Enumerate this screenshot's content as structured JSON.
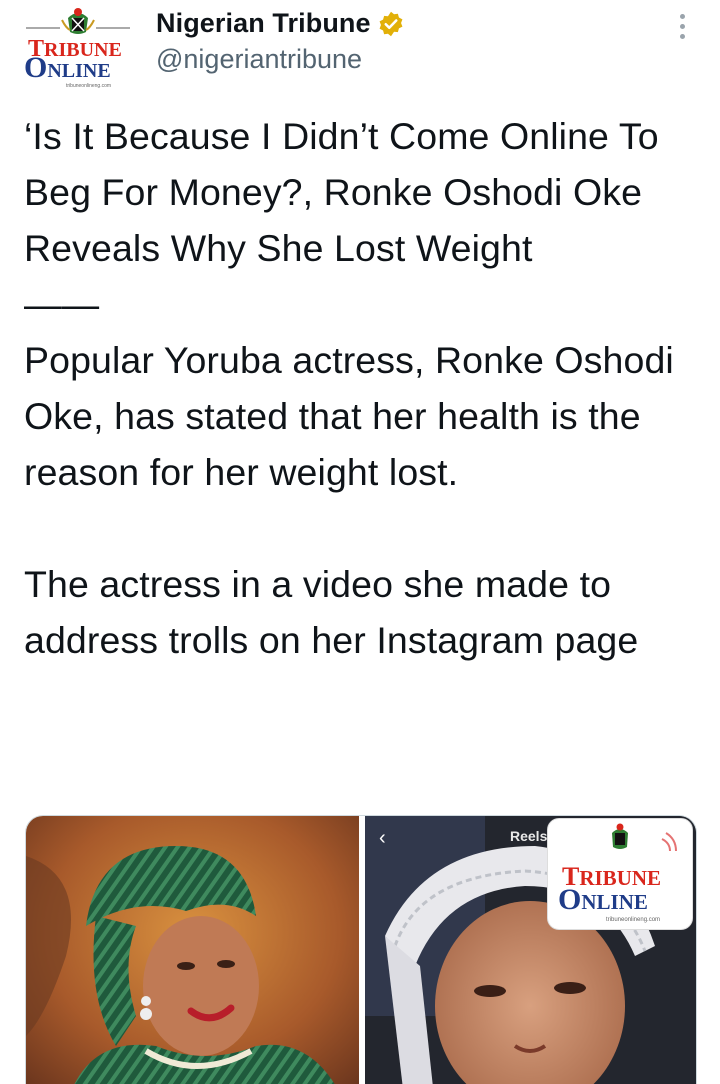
{
  "author": {
    "display_name": "Nigerian Tribune",
    "handle": "@nigeriantribune",
    "verified_icon": "verified-badge-icon",
    "avatar_logo": {
      "line1": "RIBUNE",
      "line1_initial": "T",
      "line2": "NLINE",
      "line2_initial": "O",
      "url": "tribuneonlineng.com"
    }
  },
  "tweet": {
    "text": "‘Is It Because I Didn’t Come Online To Beg For Money?, Ronke Oshodi Oke Reveals Why She Lost Weight\n——\nPopular Yoruba actress, Ronke Oshodi Oke, has stated that her health is the reason for her weight lost.\n\nThe actress in a video she made to address trolls on her Instagram page"
  },
  "media": {
    "right_image": {
      "reels_label": "Reels",
      "back_icon": "chevron-left-icon",
      "logo_line1": "RIBUNE",
      "logo_line1_initial": "T",
      "logo_line2": "NLINE",
      "logo_line2_initial": "O",
      "logo_url": "tribuneonlineng.com"
    }
  },
  "colors": {
    "text": "#0f1419",
    "secondary": "#536471",
    "verified": "#e2b008",
    "logo_red": "#d9261c",
    "logo_blue": "#1f3c88"
  }
}
